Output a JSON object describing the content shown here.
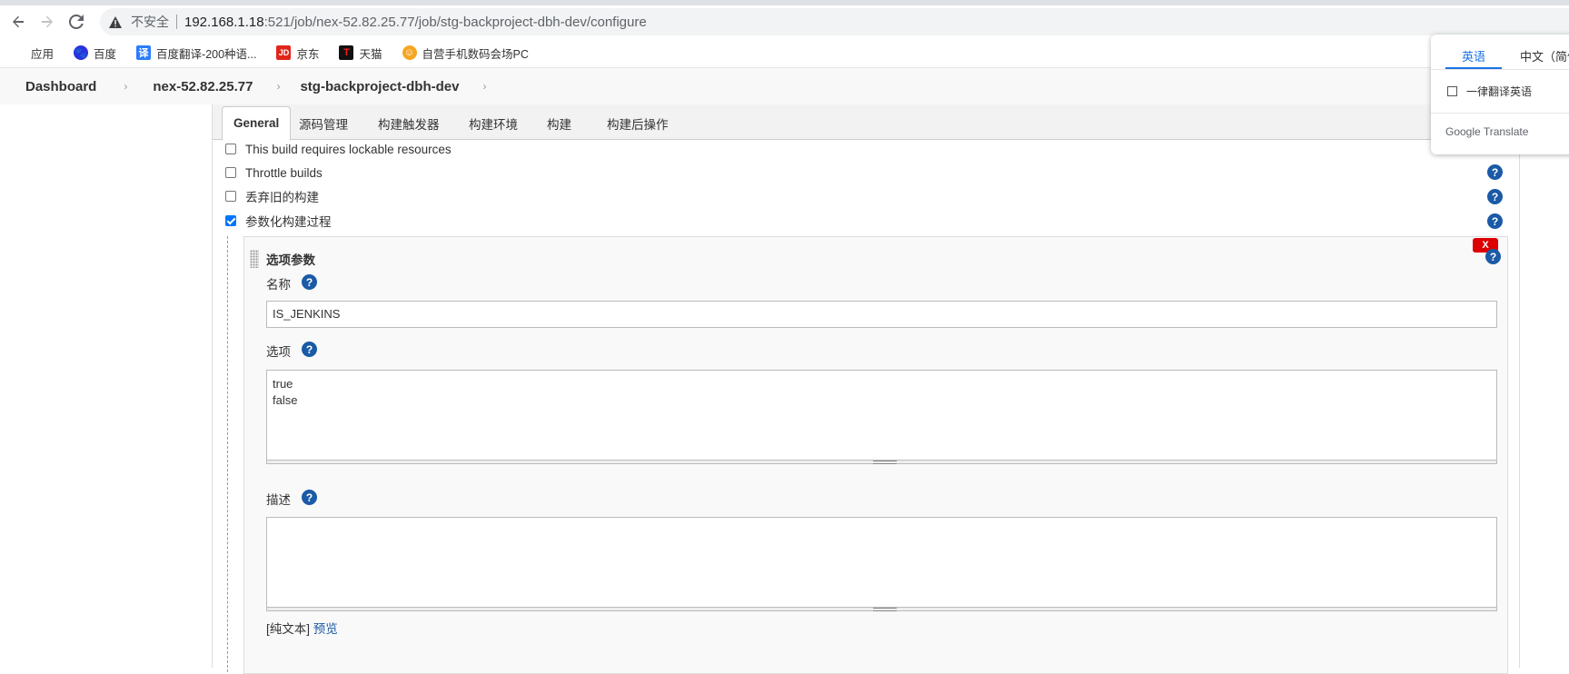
{
  "browser": {
    "insecure_label": "不安全",
    "url_host": "192.168.1.18",
    "url_path": ":521/job/nex-52.82.25.77/job/stg-backproject-dbh-dev/configure",
    "bookmarks": [
      "应用",
      "百度",
      "百度翻译-200种语...",
      "京东",
      "天猫",
      "自营手机数码会场PC"
    ],
    "bookmark_icons": {
      "apps": "apps-grid-icon",
      "baidu": "baidu-paw-icon",
      "translate": "translate-icon",
      "jd": "jd-icon",
      "tmall": "tmall-icon",
      "promo": "promo-icon"
    }
  },
  "breadcrumb": [
    "Dashboard",
    "nex-52.82.25.77",
    "stg-backproject-dbh-dev"
  ],
  "tabs": [
    "General",
    "源码管理",
    "构建触发器",
    "构建环境",
    "构建",
    "构建后操作"
  ],
  "options": [
    {
      "label": "This build requires lockable resources",
      "checked": false
    },
    {
      "label": "Throttle builds",
      "checked": false
    },
    {
      "label": "丢弃旧的构建",
      "checked": false
    },
    {
      "label": "参数化构建过程",
      "checked": true
    }
  ],
  "param": {
    "title": "选项参数",
    "delete_label": "X",
    "name_label": "名称",
    "name_value": "IS_JENKINS",
    "choices_label": "选项",
    "choices_value": "true\nfalse",
    "desc_label": "描述",
    "desc_value": "",
    "plain_text": "[纯文本]",
    "preview": "预览"
  },
  "help_glyph": "?",
  "translate": {
    "tab_english": "英语",
    "tab_chinese": "中文（简体）",
    "always_label": "一律翻译英语",
    "brand": "Google Translate"
  },
  "colors": {
    "accent": "#1a5aa6",
    "delete": "#dd0000",
    "checkbox": "#0075ff",
    "gt_blue": "#1a73e8"
  }
}
